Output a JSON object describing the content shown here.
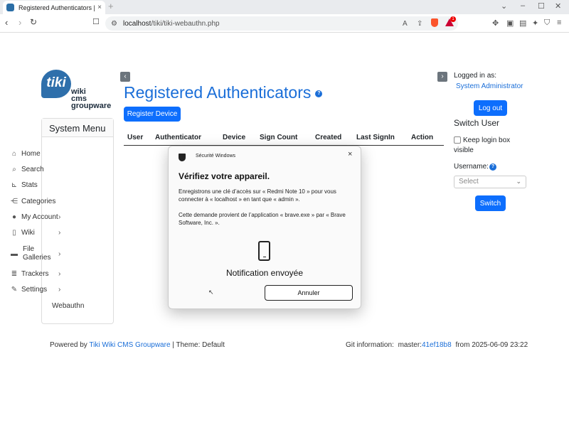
{
  "browser": {
    "tab_title": "Registered Authenticators | Tiki",
    "tab_close": "×",
    "new_tab": "+",
    "url_host": "localhost",
    "url_path": "/tiki/tiki-webauthn.php",
    "alert_count": "1"
  },
  "logo": {
    "bubble": "tiki",
    "line1": "wiki",
    "line2": "cms",
    "line3": "groupware"
  },
  "system_menu": {
    "title": "System Menu",
    "items": [
      {
        "label": "Home",
        "icon": "home-icon"
      },
      {
        "label": "Search",
        "icon": "search-icon"
      },
      {
        "label": "Stats",
        "icon": "chart-icon"
      },
      {
        "label": "Categories",
        "icon": "sitemap-icon"
      },
      {
        "label": "My Account",
        "icon": "user-icon"
      },
      {
        "label": "Wiki",
        "icon": "file-icon"
      },
      {
        "label": "File",
        "label2": "Galleries",
        "icon": "folder-icon"
      },
      {
        "label": "Trackers",
        "icon": "database-icon"
      },
      {
        "label": "Settings",
        "icon": "wrench-icon"
      },
      {
        "label": "Webauthn",
        "icon": ""
      }
    ]
  },
  "main": {
    "title": "Registered Authenticators",
    "help": "?",
    "register_button": "Register Device",
    "columns": [
      "User",
      "Authenticator",
      "Device",
      "Sign Count",
      "Created",
      "Last SignIn",
      "Action"
    ]
  },
  "right": {
    "logged_in_as": "Logged in as:",
    "user": "System Administrator",
    "logout": "Log out",
    "switch_user_title": "Switch User",
    "keep_login": "Keep login box",
    "keep_login2": "visible",
    "username_label": "Username:",
    "username_help": "?",
    "select_placeholder": "Select",
    "switch_button": "Switch"
  },
  "footer": {
    "powered_by": "Powered by",
    "powered_link": "Tiki Wiki CMS Groupware",
    "theme": "| Theme: Default",
    "git_label": "Git information:",
    "git_branch": "master:",
    "git_hash": "41ef18b8",
    "git_date": "from 2025-06-09 23:22"
  },
  "dialog": {
    "title": "Sécurité Windows",
    "close": "×",
    "heading": "Vérifiez votre appareil.",
    "para1a": "Enregistrons une clé d’accès sur « Redmi Note 10 » pour vous",
    "para1b": "connecter à « localhost » en tant que « admin ».",
    "para2a": "Cette demande provient de l’application « brave.exe » par « Brave",
    "para2b": "Software, Inc. ».",
    "notification": "Notification envoyée",
    "cancel": "Annuler"
  }
}
